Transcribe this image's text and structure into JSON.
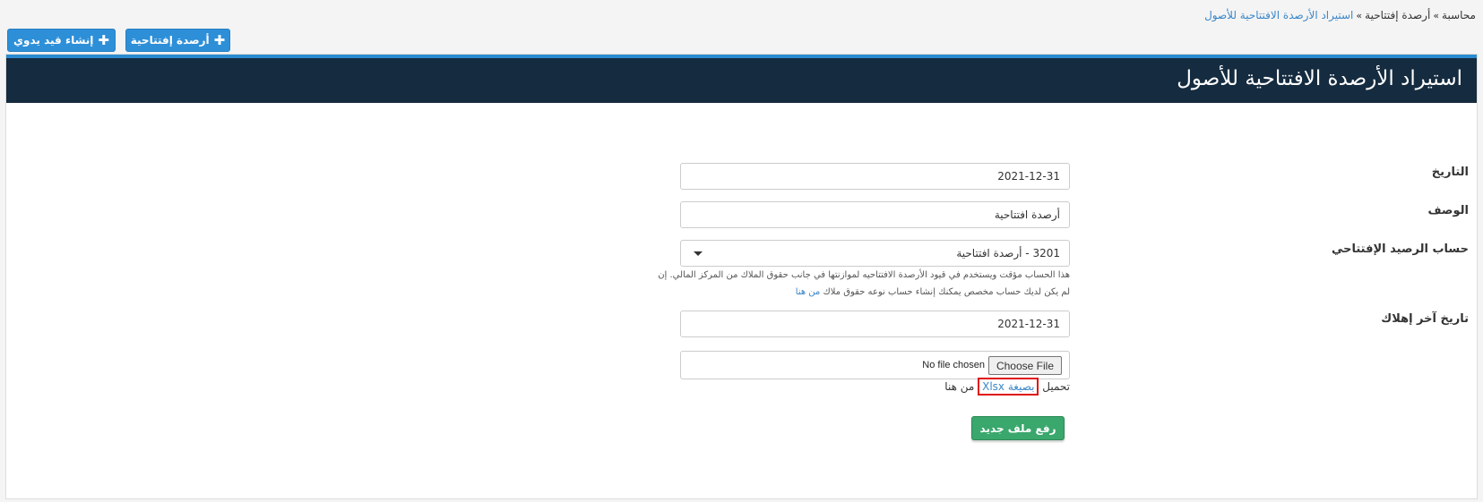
{
  "breadcrumb": {
    "items": [
      "محاسبة",
      "أرصدة إفتتاحية"
    ],
    "current": "استيراد الأرصدة الافتتاحية للأصول",
    "separator": "»"
  },
  "toolbar": {
    "opening_balances_label": "أرصدة إفتتاحية",
    "manual_entry_label": "إنشاء قيد يدوي"
  },
  "page": {
    "title": "استيراد الأرصدة الافتتاحية للأصول"
  },
  "form": {
    "date_label": "التاريخ",
    "date_value": "2021-12-31",
    "description_label": "الوصف",
    "description_value": "أرصدة افتتاحية",
    "account_label": "حساب الرصيد الإفتتاحي",
    "account_value": "3201 - أرصدة افتتاحية",
    "account_help_line1": "هذا الحساب مؤقت ويستخدم في قيود الأرصدة الافتتاحيه لموازنتها في جانب حقوق الملاك من المركز المالي. إن",
    "account_help_line2": "لم يكن لديك حساب مخصص يمكنك إنشاء حساب نوعه حقوق ملاك",
    "account_help_link": "من هنا",
    "depreciation_label": "تاريخ آخر إهلاك",
    "depreciation_value": "2021-12-31",
    "choose_file_label": "Choose File",
    "no_file_text": "No file chosen",
    "download_prefix": "تحميل",
    "download_link": "بصيغة Xlsx",
    "download_suffix": "من هنا",
    "upload_button": "رفع ملف جديد"
  },
  "colors": {
    "header_bg": "#152b3f",
    "accent_blue": "#2d8fd8",
    "upload_green": "#3aa76d",
    "highlight_red": "#e01010"
  }
}
